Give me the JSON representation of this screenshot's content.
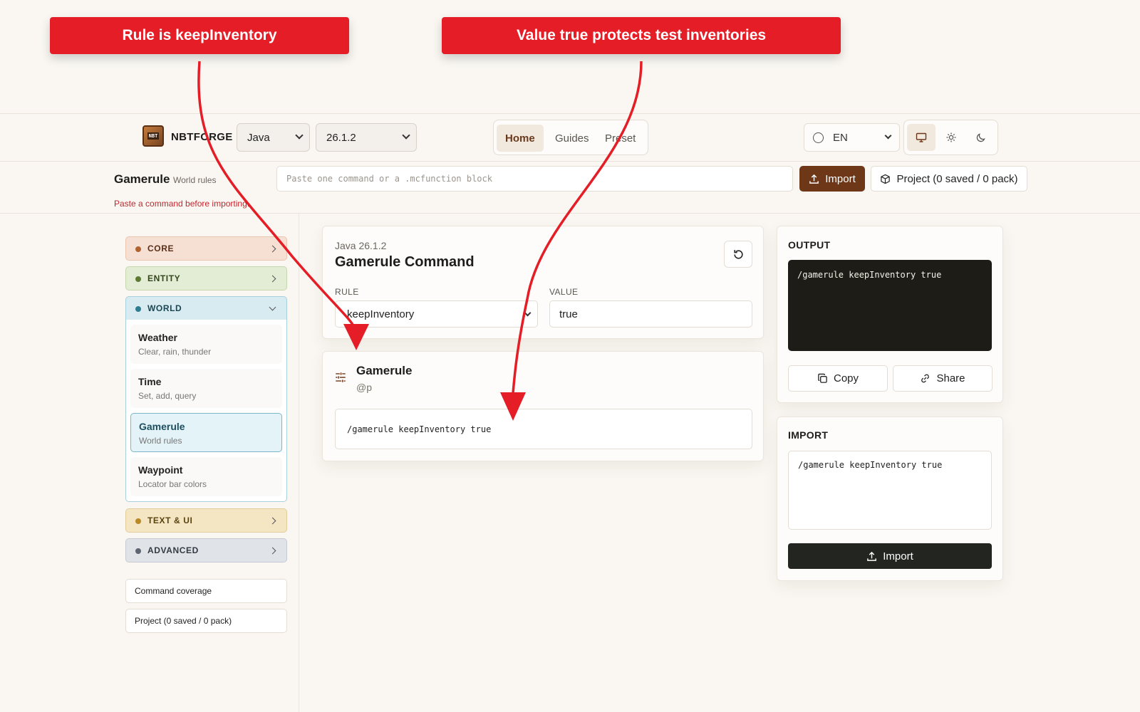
{
  "annotations": {
    "a1": "Rule is keepInventory",
    "a2": "Value true protects test inventories"
  },
  "header": {
    "logo_text": "NBT",
    "brand": "NBTFORGE",
    "edition": "Java",
    "version": "26.1.2",
    "nav": [
      "Home",
      "Guides",
      "Preset"
    ],
    "active_nav": "Home",
    "language": "EN",
    "theme_icons": [
      "monitor-icon",
      "sun-icon",
      "moon-icon"
    ],
    "active_theme": "monitor"
  },
  "command_bar": {
    "title": "Gamerule",
    "subtitle": "World rules",
    "error": "Paste a command before importing.",
    "placeholder": "Paste one command or a .mcfunction block",
    "import_label": "Import",
    "project_label": "Project (0 saved / 0 pack)"
  },
  "sidebar": {
    "categories": {
      "core": "CORE",
      "entity": "ENTITY",
      "world": "WORLD",
      "text_ui": "TEXT & UI",
      "advanced": "ADVANCED"
    },
    "world_items": [
      {
        "title": "Weather",
        "subtitle": "Clear, rain, thunder"
      },
      {
        "title": "Time",
        "subtitle": "Set, add, query"
      },
      {
        "title": "Gamerule",
        "subtitle": "World rules"
      },
      {
        "title": "Waypoint",
        "subtitle": "Locator bar colors"
      }
    ],
    "links": [
      "Command coverage",
      "Project (0 saved / 0 pack)"
    ]
  },
  "editor": {
    "version": "Java 26.1.2",
    "title": "Gamerule Command",
    "rule_label": "RULE",
    "rule_value": "keepInventory",
    "value_label": "VALUE",
    "value_value": "true"
  },
  "preview": {
    "title": "Gamerule",
    "selector": "@p",
    "code": "/gamerule keepInventory true"
  },
  "output": {
    "label": "OUTPUT",
    "code": "/gamerule keepInventory true",
    "copy_label": "Copy",
    "share_label": "Share"
  },
  "import": {
    "label": "IMPORT",
    "code": "/gamerule keepInventory true",
    "button_label": "Import"
  },
  "colors": {
    "accent": "#6e3718",
    "annotation": "#e41d26",
    "background": "#faf7f2"
  }
}
